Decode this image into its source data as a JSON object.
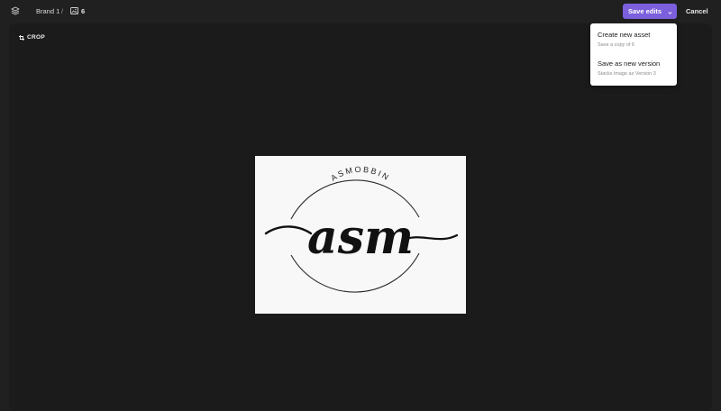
{
  "header": {
    "breadcrumb_brand": "Brand 1",
    "breadcrumb_separator": "/",
    "asset_name": "6"
  },
  "actions": {
    "save_label": "Save edits",
    "cancel_label": "Cancel"
  },
  "tools": {
    "crop_label": "CROP"
  },
  "save_menu": {
    "items": [
      {
        "title": "Create new asset",
        "subtitle": "Save a copy of 6"
      },
      {
        "title": "Save as new version",
        "subtitle": "Stacks image as Version 3"
      }
    ]
  },
  "logo": {
    "arc_text": "ASMOBBIN",
    "script_text": "asm"
  },
  "colors": {
    "accent": "#7b5fdc",
    "background": "#202020",
    "canvas": "#1b1b1b"
  }
}
